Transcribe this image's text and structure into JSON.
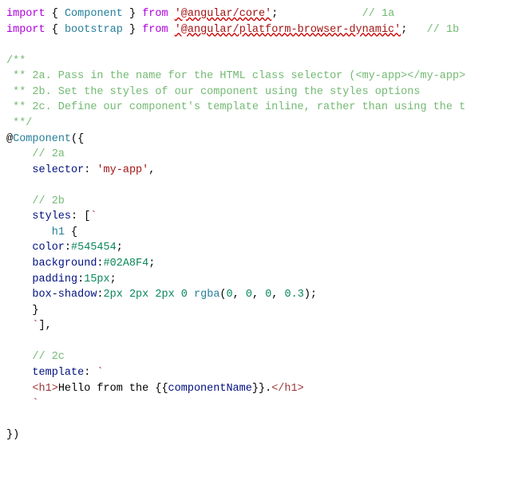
{
  "code": {
    "l1": {
      "import": "import",
      "ident": "Component",
      "from": "from",
      "mod": "'@angular/core'",
      "comment": "// 1a"
    },
    "l2": {
      "import": "import",
      "ident": "bootstrap",
      "from": "from",
      "mod": "'@angular/platform-browser-dynamic'",
      "comment": "// 1b"
    },
    "cblock": {
      "l1": "/**",
      "l2": " ** 2a. Pass in the name for the HTML class selector (<my-app></my-app>",
      "l3": " ** 2b. Set the styles of our component using the styles options",
      "l4": " ** 2c. Define our component's template inline, rather than using the t",
      "l5": " **/"
    },
    "dec": {
      "name": "Component"
    },
    "body": {
      "c2a": "// 2a",
      "selectorKey": "selector",
      "selectorVal": "'my-app'",
      "c2b": "// 2b",
      "stylesKey": "styles",
      "h1": "h1",
      "color": {
        "k": "color",
        "v": "#545454"
      },
      "bg": {
        "k": "background",
        "v": "#02A8F4"
      },
      "pad": {
        "k": "padding",
        "v": "15px"
      },
      "bs": {
        "k": "box-shadow",
        "v1": "2px",
        "v2": "2px",
        "v3": "2px",
        "v4": "0",
        "fn": "rgba",
        "a1": "0",
        "a2": "0",
        "a3": "0",
        "a4": "0.3"
      },
      "c2c": "// 2c",
      "tplKey": "template",
      "tpl": {
        "open": "<h1>",
        "text1": "Hello from the ",
        "expr": "componentName",
        "text2": ".",
        "close": "</h1>"
      }
    }
  }
}
